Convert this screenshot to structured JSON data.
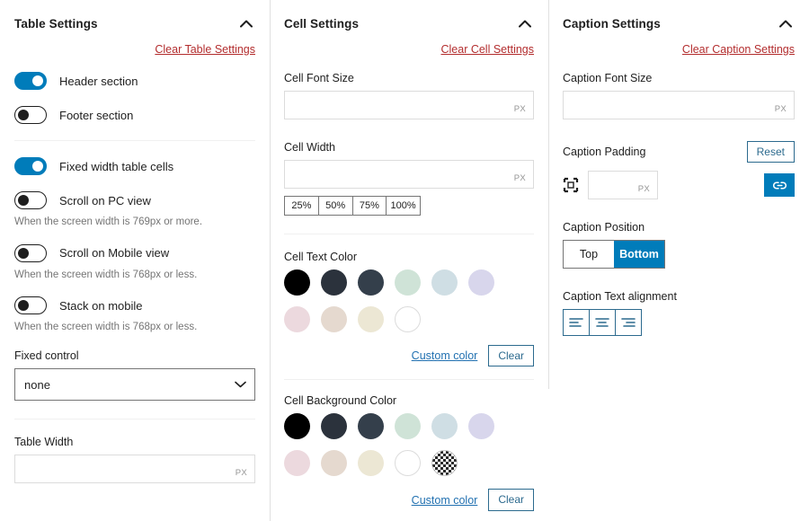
{
  "colors": {
    "accent": "#007cba",
    "clear_link": "#b32d2e",
    "custom_color_link": "#2271b1",
    "outline_button": "#2c6a8e",
    "text": "#1e1e1e",
    "muted_text": "#757575"
  },
  "table_settings": {
    "title": "Table Settings",
    "collapse_icon": "chevron-up-icon",
    "clear_label": "Clear Table Settings",
    "toggles": [
      {
        "label": "Header section",
        "state": "on"
      },
      {
        "label": "Footer section",
        "state": "off"
      },
      {
        "label": "Fixed width table cells",
        "state": "on"
      },
      {
        "label": "Scroll on PC view",
        "state": "off",
        "help": "When the screen width is 769px or more."
      },
      {
        "label": "Scroll on Mobile view",
        "state": "off",
        "help": "When the screen width is 768px or less."
      },
      {
        "label": "Stack on mobile",
        "state": "off",
        "help": "When the screen width is 768px or less."
      }
    ],
    "fixed_control": {
      "label": "Fixed control",
      "value": "none",
      "options": [
        "none"
      ],
      "chevron_icon": "chevron-down-icon"
    },
    "table_width": {
      "label": "Table Width",
      "value": "",
      "placeholder": "",
      "unit": "PX"
    }
  },
  "cell_settings": {
    "title": "Cell Settings",
    "collapse_icon": "chevron-up-icon",
    "clear_label": "Clear Cell Settings",
    "font_size": {
      "label": "Cell Font Size",
      "value": "",
      "placeholder": "",
      "unit": "PX"
    },
    "cell_width": {
      "label": "Cell Width",
      "value": "",
      "placeholder": "",
      "unit": "PX"
    },
    "width_presets": [
      "25%",
      "50%",
      "75%",
      "100%"
    ],
    "text_color": {
      "label": "Cell Text Color",
      "swatches": [
        {
          "name": "black",
          "hex": "#000000"
        },
        {
          "name": "dark-slate",
          "hex": "#2b323c"
        },
        {
          "name": "charcoal",
          "hex": "#343f4b"
        },
        {
          "name": "mint",
          "hex": "#cfe3d7"
        },
        {
          "name": "pale-blue",
          "hex": "#cfdee4"
        },
        {
          "name": "lavender",
          "hex": "#d8d6ec"
        },
        {
          "name": "rose",
          "hex": "#ecd9de"
        },
        {
          "name": "tan",
          "hex": "#e5d9cf"
        },
        {
          "name": "cream",
          "hex": "#ece7d4"
        },
        {
          "name": "white",
          "hex": "#ffffff"
        }
      ],
      "custom_label": "Custom color",
      "clear_label": "Clear"
    },
    "background_color": {
      "label": "Cell Background Color",
      "swatches": [
        {
          "name": "black",
          "hex": "#000000"
        },
        {
          "name": "dark-slate",
          "hex": "#2b323c"
        },
        {
          "name": "charcoal",
          "hex": "#343f4b"
        },
        {
          "name": "mint",
          "hex": "#cfe3d7"
        },
        {
          "name": "pale-blue",
          "hex": "#cfdee4"
        },
        {
          "name": "lavender",
          "hex": "#d8d6ec"
        },
        {
          "name": "rose",
          "hex": "#ecd9de"
        },
        {
          "name": "tan",
          "hex": "#e5d9cf"
        },
        {
          "name": "cream",
          "hex": "#ece7d4"
        },
        {
          "name": "white",
          "hex": "#ffffff"
        },
        {
          "name": "transparent",
          "hex": "transparent"
        }
      ],
      "custom_label": "Custom color",
      "clear_label": "Clear"
    }
  },
  "caption_settings": {
    "title": "Caption Settings",
    "collapse_icon": "chevron-up-icon",
    "clear_label": "Clear Caption Settings",
    "font_size": {
      "label": "Caption Font Size",
      "value": "",
      "placeholder": "",
      "unit": "PX"
    },
    "padding": {
      "label": "Caption Padding",
      "reset_label": "Reset",
      "value": "",
      "placeholder": "",
      "unit": "PX",
      "side_icon": "all-sides-padding-icon",
      "link_icon": "link-sides-icon"
    },
    "position": {
      "label": "Caption Position",
      "options": [
        "Top",
        "Bottom"
      ],
      "selected": "Bottom"
    },
    "text_alignment": {
      "label": "Caption Text alignment",
      "options": [
        "align-left-icon",
        "align-center-icon",
        "align-right-icon"
      ],
      "selected": ""
    }
  }
}
